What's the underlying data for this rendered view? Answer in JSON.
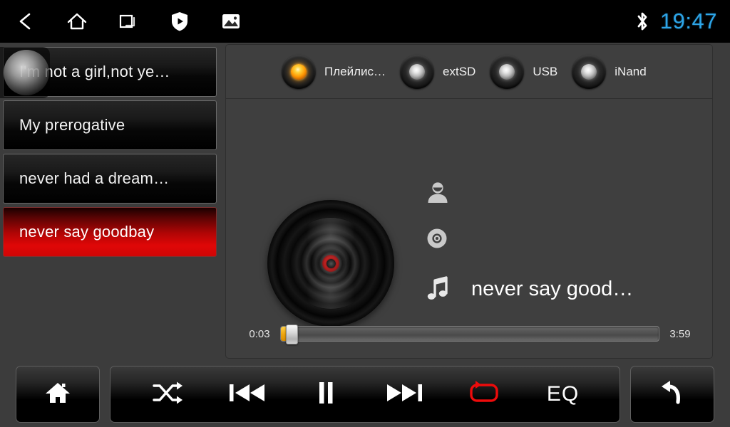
{
  "statusbar": {
    "nav_icons": [
      {
        "name": "back-icon",
        "label": "Back"
      },
      {
        "name": "home-icon",
        "label": "Home"
      },
      {
        "name": "recents-icon",
        "label": "Recent apps"
      },
      {
        "name": "shield-play-icon",
        "label": "Protection"
      },
      {
        "name": "gallery-icon",
        "label": "Gallery"
      }
    ],
    "bluetooth_icon": "bluetooth-icon",
    "clock": "19:47",
    "clock_color": "#2da5e8"
  },
  "playlist": {
    "items": [
      {
        "title": "I'm not a girl,not ye…",
        "selected": false,
        "pressed": true
      },
      {
        "title": "My prerogative",
        "selected": false,
        "pressed": false
      },
      {
        "title": "never had a dream…",
        "selected": false,
        "pressed": false
      },
      {
        "title": "never say goodbay",
        "selected": true,
        "pressed": false
      }
    ],
    "selected_color": "#e00707"
  },
  "sources": {
    "tabs": [
      {
        "label": "Плейлис…",
        "active": true
      },
      {
        "label": "extSD",
        "active": false
      },
      {
        "label": "USB",
        "active": false
      },
      {
        "label": "iNand",
        "active": false
      }
    ],
    "active_led_color": "#ff9b05",
    "inactive_led_color": "#e8e8e8"
  },
  "now_playing": {
    "artist": "",
    "album": "",
    "title": "never say good…",
    "artist_icon": "person-icon",
    "album_icon": "disc-icon",
    "title_icon": "music-note-icon",
    "disc_icon": "vinyl-disc"
  },
  "progress": {
    "elapsed": "0:03",
    "total": "3:59",
    "percent": 1.3,
    "fill_color": "#f0a810"
  },
  "controls": {
    "home": {
      "label": "Home",
      "icon": "home-filled-icon"
    },
    "shuffle": {
      "label": "Shuffle",
      "icon": "shuffle-icon"
    },
    "previous": {
      "label": "Previous",
      "icon": "previous-track-icon"
    },
    "pause": {
      "label": "Pause",
      "icon": "pause-icon"
    },
    "next": {
      "label": "Next",
      "icon": "next-track-icon"
    },
    "repeat": {
      "label": "Repeat",
      "icon": "repeat-icon",
      "active": true,
      "color": "#ee0b0b"
    },
    "eq": {
      "label": "EQ",
      "icon": "equalizer-label"
    },
    "back": {
      "label": "Back",
      "icon": "return-arrow-icon"
    }
  }
}
